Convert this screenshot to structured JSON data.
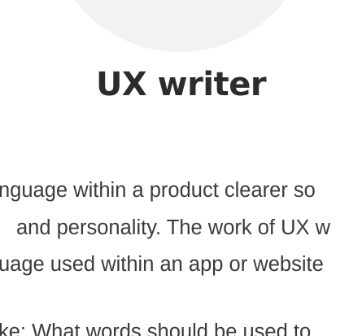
{
  "card": {
    "title": "UX writer",
    "description_lines": [
      "nguage within a product clearer so",
      "and personality. The work of UX w",
      "uage used within an app or website",
      "ke: What words should be used to"
    ]
  }
}
